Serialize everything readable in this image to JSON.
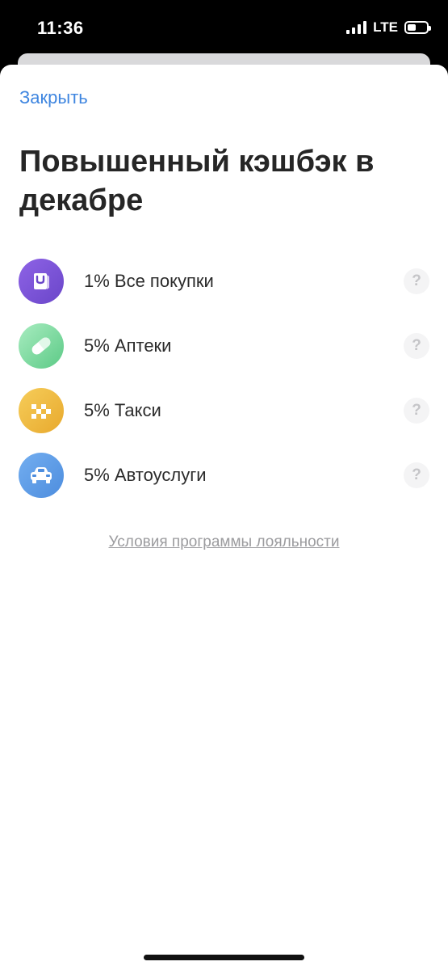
{
  "status_bar": {
    "time": "11:36",
    "network": "LTE"
  },
  "sheet": {
    "close_label": "Закрыть",
    "title": "Повышенный кэшбэк в декабре",
    "help_symbol": "?",
    "items": [
      {
        "label": "1% Все покупки",
        "icon": "shopping-bag-icon",
        "color_from": "#8e63e6",
        "color_to": "#6a46c9"
      },
      {
        "label": "5% Аптеки",
        "icon": "pill-icon",
        "color_from": "#a8ecc0",
        "color_to": "#5cca86"
      },
      {
        "label": "5% Такси",
        "icon": "taxi-icon",
        "color_from": "#f6cd5a",
        "color_to": "#e8a92d"
      },
      {
        "label": "5% Автоуслуги",
        "icon": "car-icon",
        "color_from": "#73aef0",
        "color_to": "#4d8dde"
      }
    ],
    "loyalty_link": "Условия программы лояльности"
  },
  "colors": {
    "accent": "#3f86e0",
    "title": "#262626"
  }
}
